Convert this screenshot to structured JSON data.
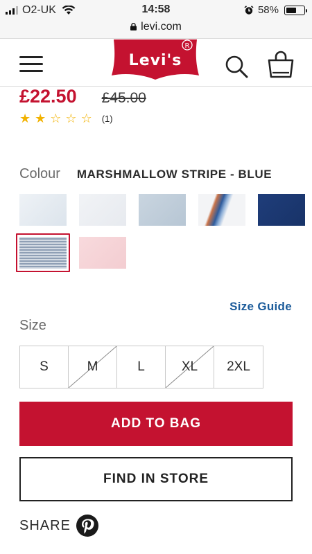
{
  "status_bar": {
    "carrier": "O2-UK",
    "time": "14:58",
    "battery": "58%",
    "battery_level": 0.58,
    "url": "levi.com"
  },
  "header": {
    "logo_text": "Levi's",
    "icons": [
      "menu-icon",
      "search-icon",
      "shopping-bag-icon"
    ]
  },
  "product": {
    "price_sale": "£22.50",
    "price_original": "£45.00",
    "rating": 2,
    "rating_max": 5,
    "rating_count": "(1)"
  },
  "colour": {
    "label": "Colour",
    "selected": "MARSHMALLOW STRIPE - BLUE",
    "swatches": [
      {
        "colors": [
          "#eef2f6",
          "#dce4ec"
        ]
      },
      {
        "colors": [
          "#f1f3f6",
          "#e7eaef"
        ]
      },
      {
        "colors": [
          "#c9d5e0",
          "#b7c6d4"
        ]
      },
      {
        "colors": [
          "#f3f4f6",
          "#2e5b9c"
        ]
      },
      {
        "colors": [
          "#1f3d7a",
          "#183368"
        ]
      },
      {
        "colors": [
          "#d3dae3",
          "#8f9fb5"
        ],
        "selected": true
      },
      {
        "colors": [
          "#f8dadd",
          "#f3cdd1"
        ]
      }
    ]
  },
  "size": {
    "label": "Size",
    "guide_link": "Size Guide",
    "options": [
      {
        "label": "S",
        "available": true
      },
      {
        "label": "M",
        "available": false
      },
      {
        "label": "L",
        "available": true
      },
      {
        "label": "XL",
        "available": false
      },
      {
        "label": "2XL",
        "available": true
      }
    ]
  },
  "actions": {
    "add_to_bag": "ADD TO BAG",
    "find_in_store": "FIND IN STORE"
  },
  "share": {
    "label": "SHARE"
  },
  "colors": {
    "brand_red": "#c41230",
    "link_blue": "#1b5b9a",
    "star_yellow": "#f2b200"
  }
}
